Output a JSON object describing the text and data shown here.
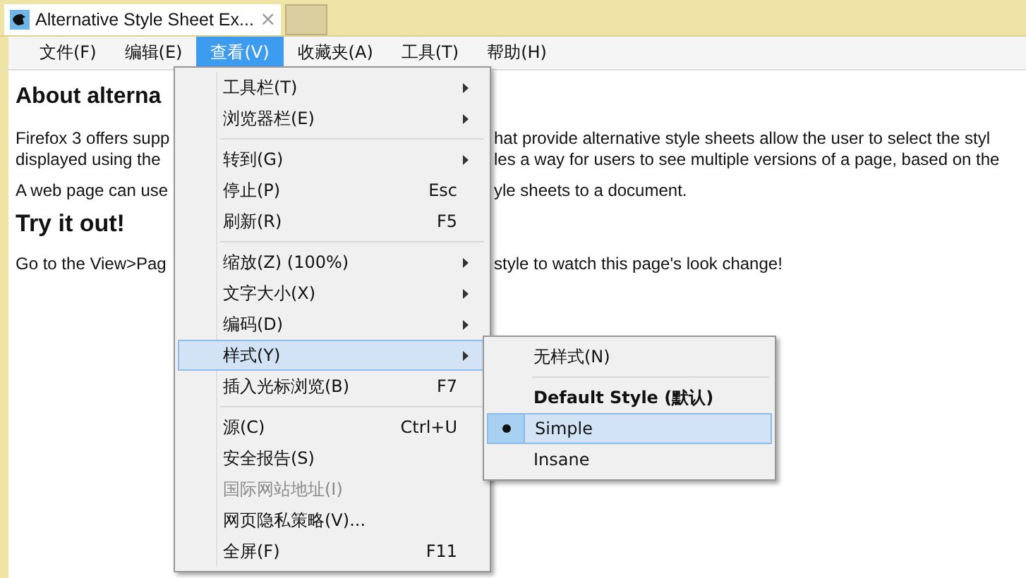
{
  "tab": {
    "title": "Alternative Style Sheet Ex...",
    "close": "×"
  },
  "menubar": [
    {
      "label": "文件(F)",
      "selected": false
    },
    {
      "label": "编辑(E)",
      "selected": false
    },
    {
      "label": "查看(V)",
      "selected": true
    },
    {
      "label": "收藏夹(A)",
      "selected": false
    },
    {
      "label": "工具(T)",
      "selected": false
    },
    {
      "label": "帮助(H)",
      "selected": false
    }
  ],
  "page": {
    "lines": [
      {
        "kind": "h1",
        "left": "About alterna"
      },
      {
        "kind": "p",
        "left": "Firefox 3 offers supp",
        "right": "hat provide alternative style sheets allow the user to select the styl"
      },
      {
        "kind": "p-cont",
        "left": "displayed using the",
        "right": "les a way for users to see multiple versions of a page, based on the"
      },
      {
        "kind": "p",
        "left": "A web page can use",
        "right": "yle sheets to a document."
      },
      {
        "kind": "h2",
        "left": "Try it out!"
      },
      {
        "kind": "p",
        "left": "Go to the View>Pag",
        "right": "style to watch this page's look change!"
      }
    ]
  },
  "view_menu": [
    {
      "kind": "item",
      "label": "工具栏(T)",
      "submenu": true,
      "selected": false,
      "disabled": false
    },
    {
      "kind": "item",
      "label": "浏览器栏(E)",
      "submenu": true,
      "selected": false,
      "disabled": false
    },
    {
      "kind": "separator"
    },
    {
      "kind": "item",
      "label": "转到(G)",
      "submenu": true,
      "selected": false,
      "disabled": false
    },
    {
      "kind": "item",
      "label": "停止(P)",
      "shortcut": "Esc",
      "submenu": false,
      "selected": false,
      "disabled": false
    },
    {
      "kind": "item",
      "label": "刷新(R)",
      "shortcut": "F5",
      "submenu": false,
      "selected": false,
      "disabled": false
    },
    {
      "kind": "separator"
    },
    {
      "kind": "item",
      "label": "缩放(Z) (100%)",
      "submenu": true,
      "selected": false,
      "disabled": false
    },
    {
      "kind": "item",
      "label": "文字大小(X)",
      "submenu": true,
      "selected": false,
      "disabled": false
    },
    {
      "kind": "item",
      "label": "编码(D)",
      "submenu": true,
      "selected": false,
      "disabled": false
    },
    {
      "kind": "item",
      "label": "样式(Y)",
      "submenu": true,
      "selected": true,
      "disabled": false
    },
    {
      "kind": "item",
      "label": "插入光标浏览(B)",
      "shortcut": "F7",
      "submenu": false,
      "selected": false,
      "disabled": false
    },
    {
      "kind": "separator"
    },
    {
      "kind": "item",
      "label": "源(C)",
      "shortcut": "Ctrl+U",
      "submenu": false,
      "selected": false,
      "disabled": false
    },
    {
      "kind": "item",
      "label": "安全报告(S)",
      "submenu": false,
      "selected": false,
      "disabled": false
    },
    {
      "kind": "item",
      "label": "国际网站地址(I)",
      "submenu": false,
      "selected": false,
      "disabled": true
    },
    {
      "kind": "item",
      "label": "网页隐私策略(V)...",
      "submenu": false,
      "selected": false,
      "disabled": false
    },
    {
      "kind": "item",
      "label": "全屏(F)",
      "shortcut": "F11",
      "submenu": false,
      "selected": false,
      "disabled": false
    }
  ],
  "style_menu": [
    {
      "kind": "item",
      "label": "无样式(N)",
      "selected": false,
      "bold": false
    },
    {
      "kind": "separator"
    },
    {
      "kind": "item",
      "label": "Default Style (默认)",
      "selected": false,
      "bold": true
    },
    {
      "kind": "item",
      "label": "Simple",
      "selected": true,
      "bold": false
    },
    {
      "kind": "item",
      "label": "Insane",
      "selected": false,
      "bold": false
    }
  ]
}
